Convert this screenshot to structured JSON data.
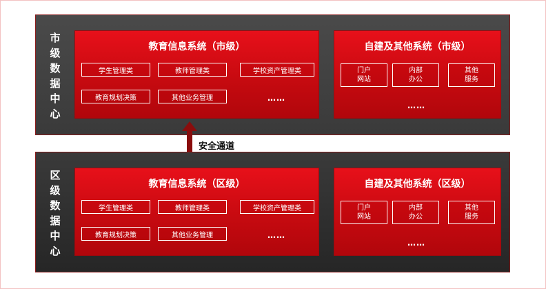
{
  "city": {
    "label_chars": [
      "市",
      "级",
      "数",
      "据",
      "中",
      "心"
    ],
    "edu": {
      "title": "教育信息系统（市级）",
      "items": [
        "学生管理类",
        "教师管理类",
        "学校资产管理类",
        "教育规划决策",
        "其他业务管理"
      ],
      "more": "……"
    },
    "own": {
      "title": "自建及其他系统（市级）",
      "items": [
        "门户\n网站",
        "内部\n办公",
        "其他\n服务"
      ],
      "more": "……"
    }
  },
  "district": {
    "label_chars": [
      "区",
      "级",
      "数",
      "据",
      "中",
      "心"
    ],
    "edu": {
      "title": "教育信息系统（区级）",
      "items": [
        "学生管理类",
        "教师管理类",
        "学校资产管理类",
        "教育规划决策",
        "其他业务管理"
      ],
      "more": "……"
    },
    "own": {
      "title": "自建及其他系统（区级）",
      "items": [
        "门户\n网站",
        "内部\n办公",
        "其他\n服务"
      ],
      "more": "……"
    }
  },
  "channel": {
    "label": "安全通道",
    "icon": "double-arrow-icon",
    "color": "#8a0d0d"
  },
  "colors": {
    "panel": "#d90c14",
    "band_dark": "#3a3a3a",
    "frame": "#f3c2c2"
  }
}
